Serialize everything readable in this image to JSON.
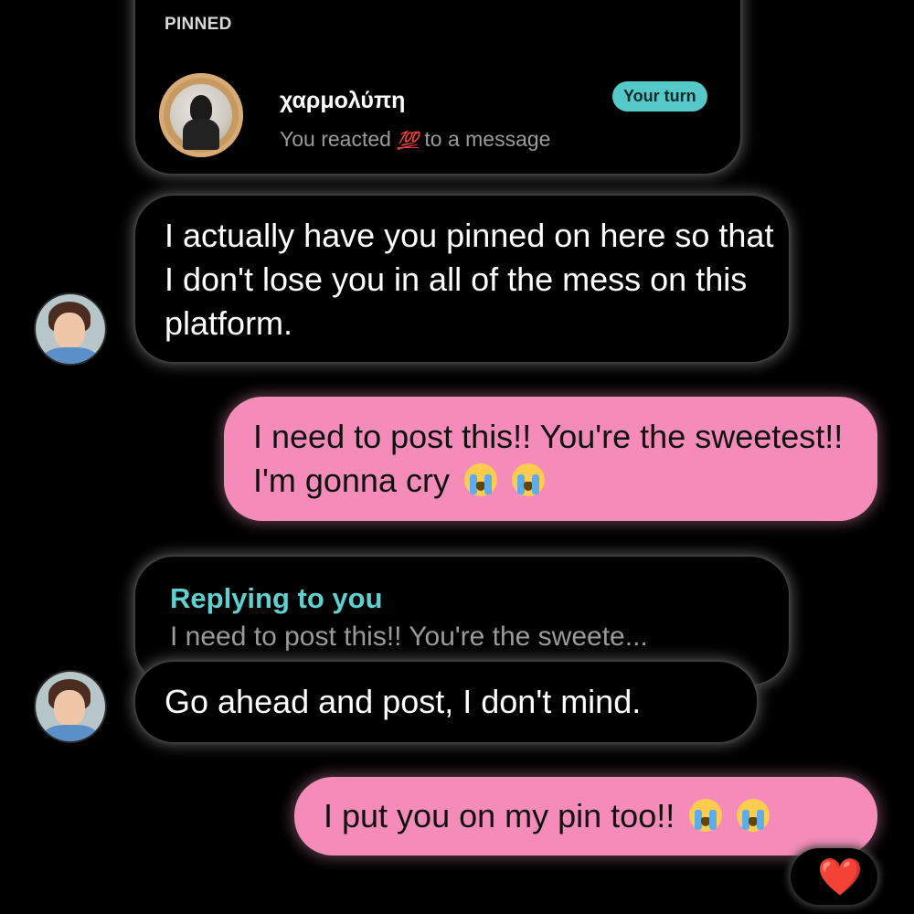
{
  "pinned": {
    "label": "PINNED",
    "name": "χαρμολύπη",
    "preview_prefix": "You reacted",
    "preview_emoji": "💯",
    "preview_suffix": "to a message",
    "badge": "Your turn"
  },
  "messages": [
    {
      "direction": "incoming",
      "text": "I actually have you pinned on here so that I don't lose you in all of the mess on this platform."
    },
    {
      "direction": "outgoing",
      "text": "I need to post this!! You're the sweetest!! I'm gonna cry",
      "emojis": [
        "loudly-crying-face",
        "loudly-crying-face"
      ]
    },
    {
      "direction": "incoming",
      "reply_label": "Replying to you",
      "reply_preview": "I need to post this!! You're the sweete...",
      "text": "Go ahead and post, I don't mind."
    },
    {
      "direction": "outgoing",
      "text": "I put you on my pin too!!",
      "emojis": [
        "loudly-crying-face",
        "loudly-crying-face"
      ],
      "reaction": "❤️"
    }
  ],
  "colors": {
    "background": "#000000",
    "outgoing_bubble": "#f48bb8",
    "accent": "#55c9c9"
  }
}
